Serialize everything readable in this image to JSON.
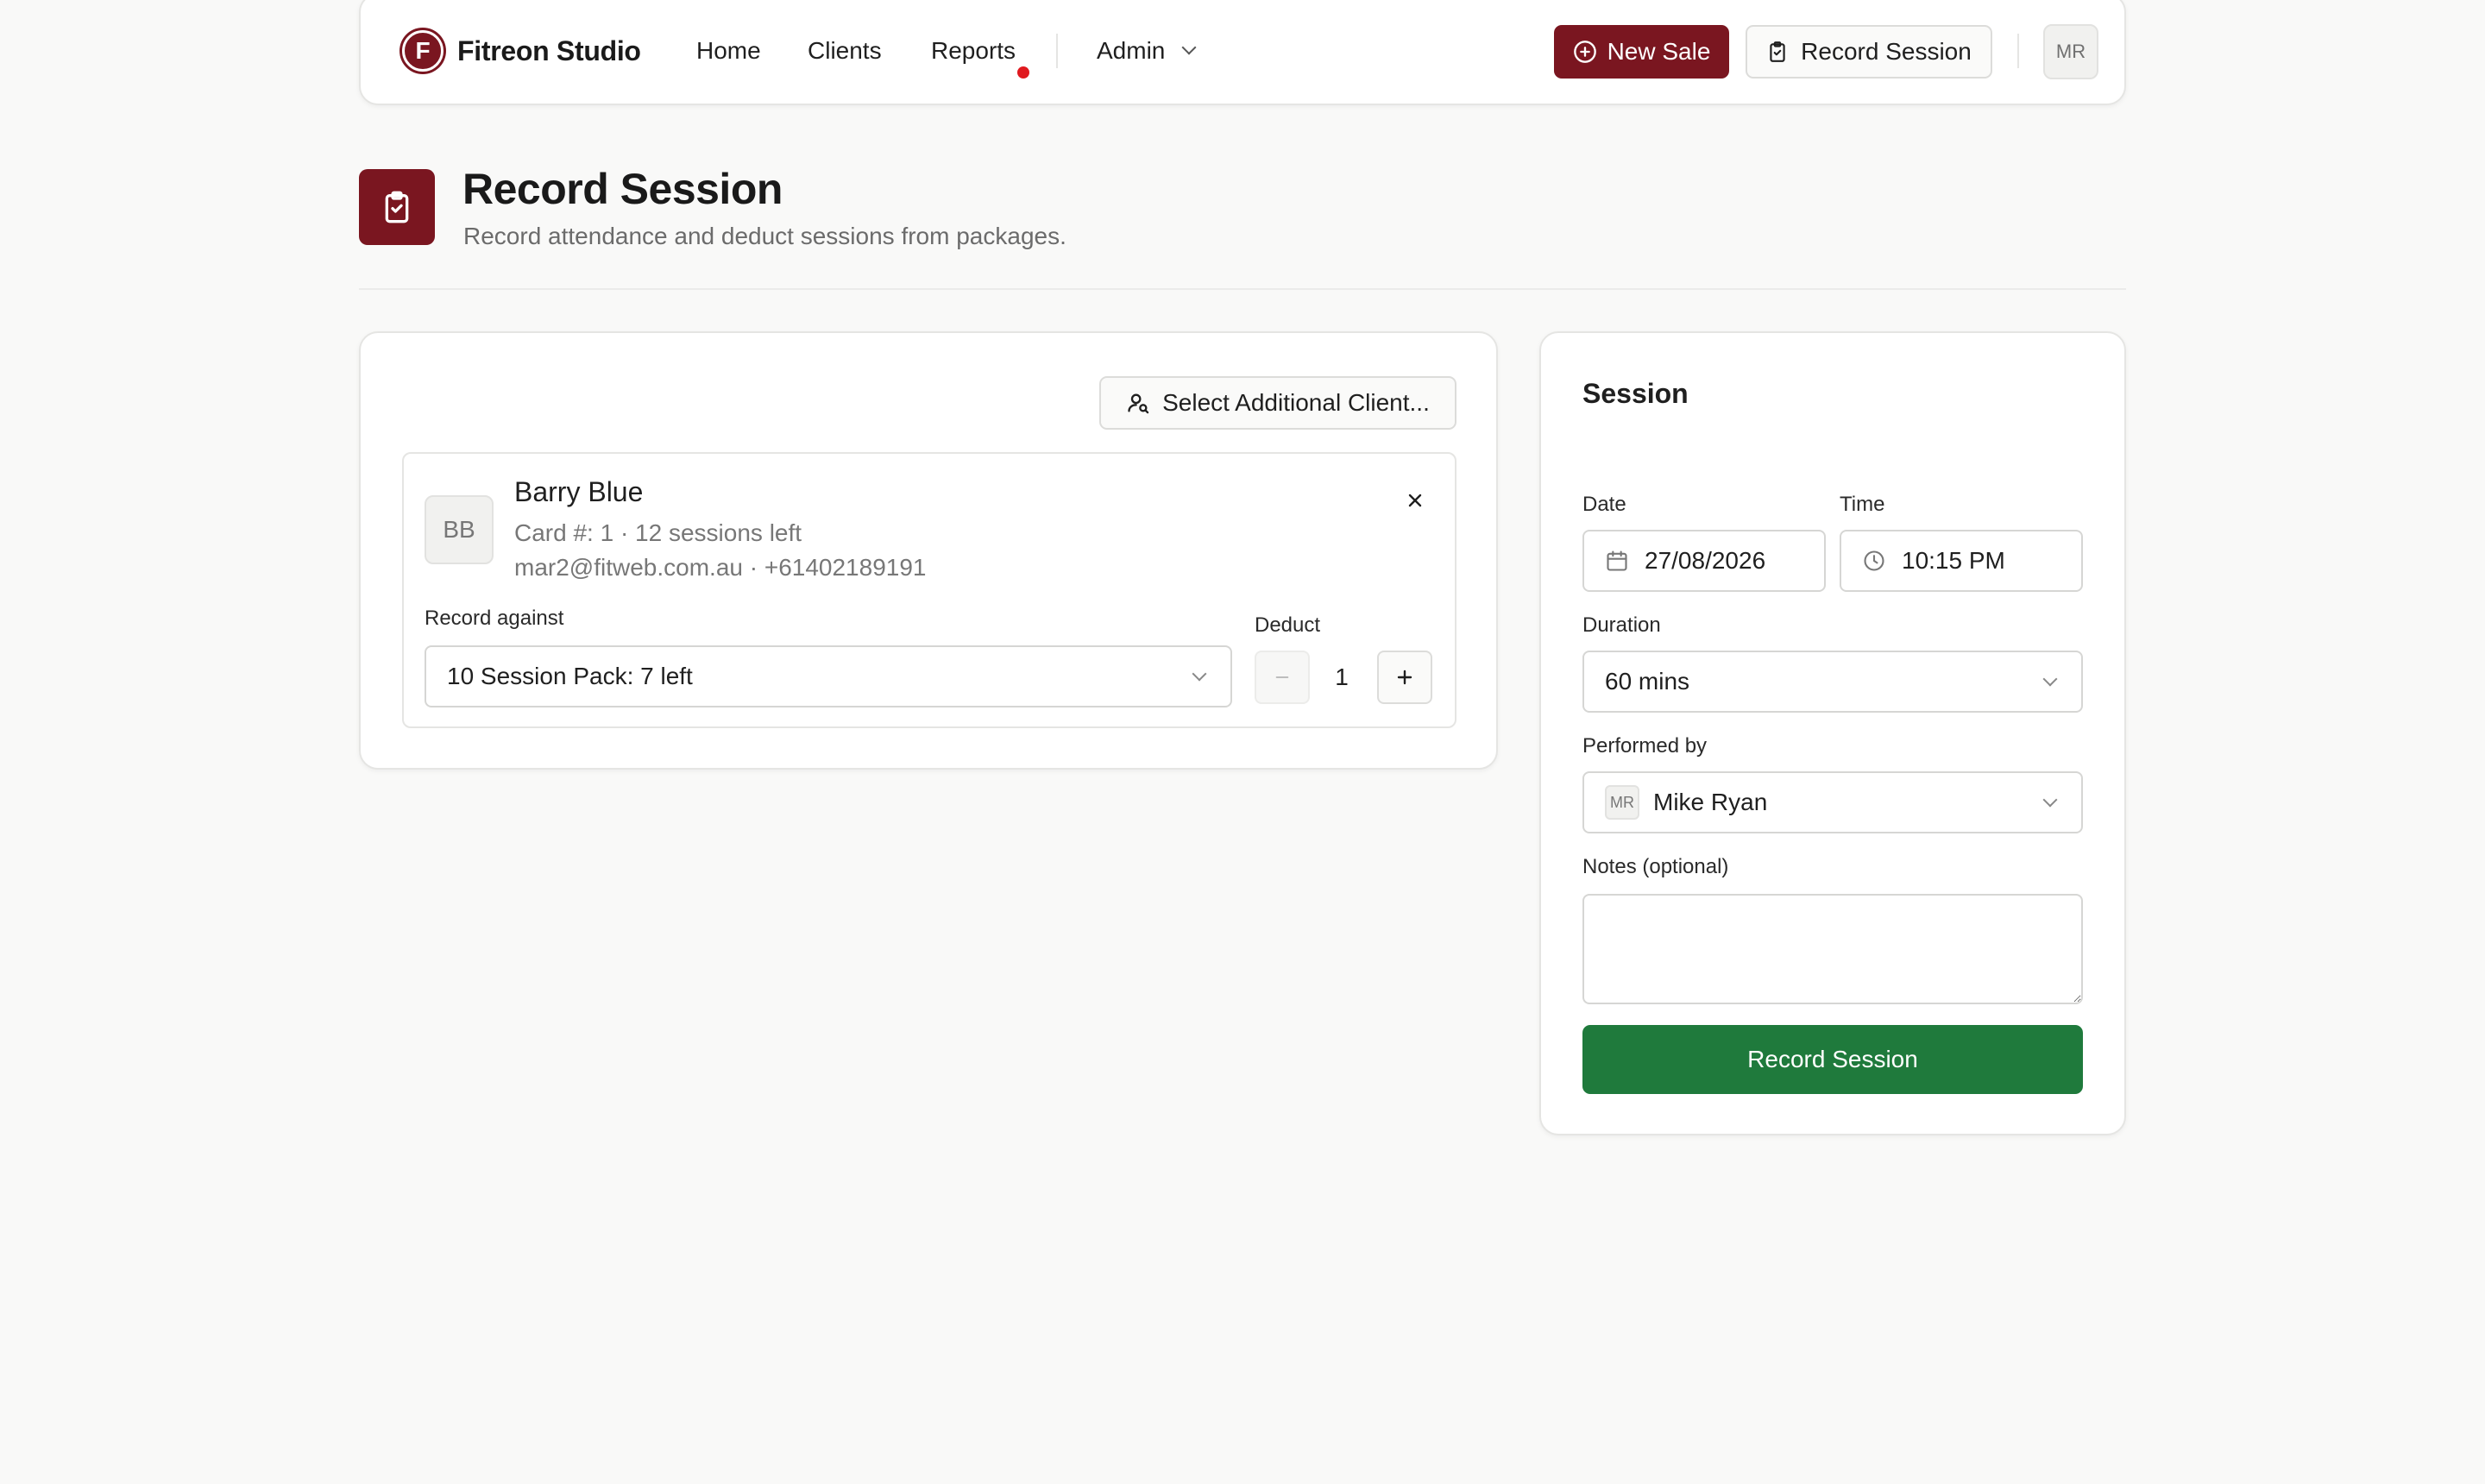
{
  "nav": {
    "brand_initial": "F",
    "brand_name": "Fitreon Studio",
    "links": [
      {
        "label": "Home"
      },
      {
        "label": "Clients"
      },
      {
        "label": "Reports",
        "has_notification": true
      },
      {
        "label": "Admin",
        "has_dropdown": true
      }
    ],
    "new_sale_label": "New Sale",
    "record_session_label": "Record Session",
    "user_initials": "MR"
  },
  "header": {
    "title": "Record Session",
    "subtitle": "Record attendance and deduct sessions from packages."
  },
  "clients_panel": {
    "select_additional_label": "Select Additional Client...",
    "client": {
      "initials": "BB",
      "name": "Barry Blue",
      "card_info": "Card #: 1 · 12 sessions left",
      "contact": "mar2@fitweb.com.au · +61402189191",
      "record_against_label": "Record against",
      "record_against_value": "10 Session Pack: 7 left",
      "deduct_label": "Deduct",
      "deduct_value": "1"
    }
  },
  "session_panel": {
    "title": "Session",
    "date_label": "Date",
    "date_value": "27/08/2026",
    "time_label": "Time",
    "time_value": "10:15 PM",
    "duration_label": "Duration",
    "duration_value": "60 mins",
    "performed_by_label": "Performed by",
    "performed_by_initials": "MR",
    "performed_by_value": "Mike Ryan",
    "notes_label": "Notes (optional)",
    "notes_value": "",
    "submit_label": "Record Session"
  },
  "colors": {
    "brand": "#7a1620",
    "success": "#1f7a3c",
    "notification": "#e0191f",
    "background": "#f9f9f8"
  },
  "icons": {
    "brand": "brand-logo-icon",
    "new_sale": "plus-circle-icon",
    "record_session": "clipboard-check-icon",
    "select_client": "user-search-icon",
    "remove_client": "close-icon",
    "date": "calendar-icon",
    "time": "clock-icon",
    "dropdown": "chevron-down-icon"
  }
}
